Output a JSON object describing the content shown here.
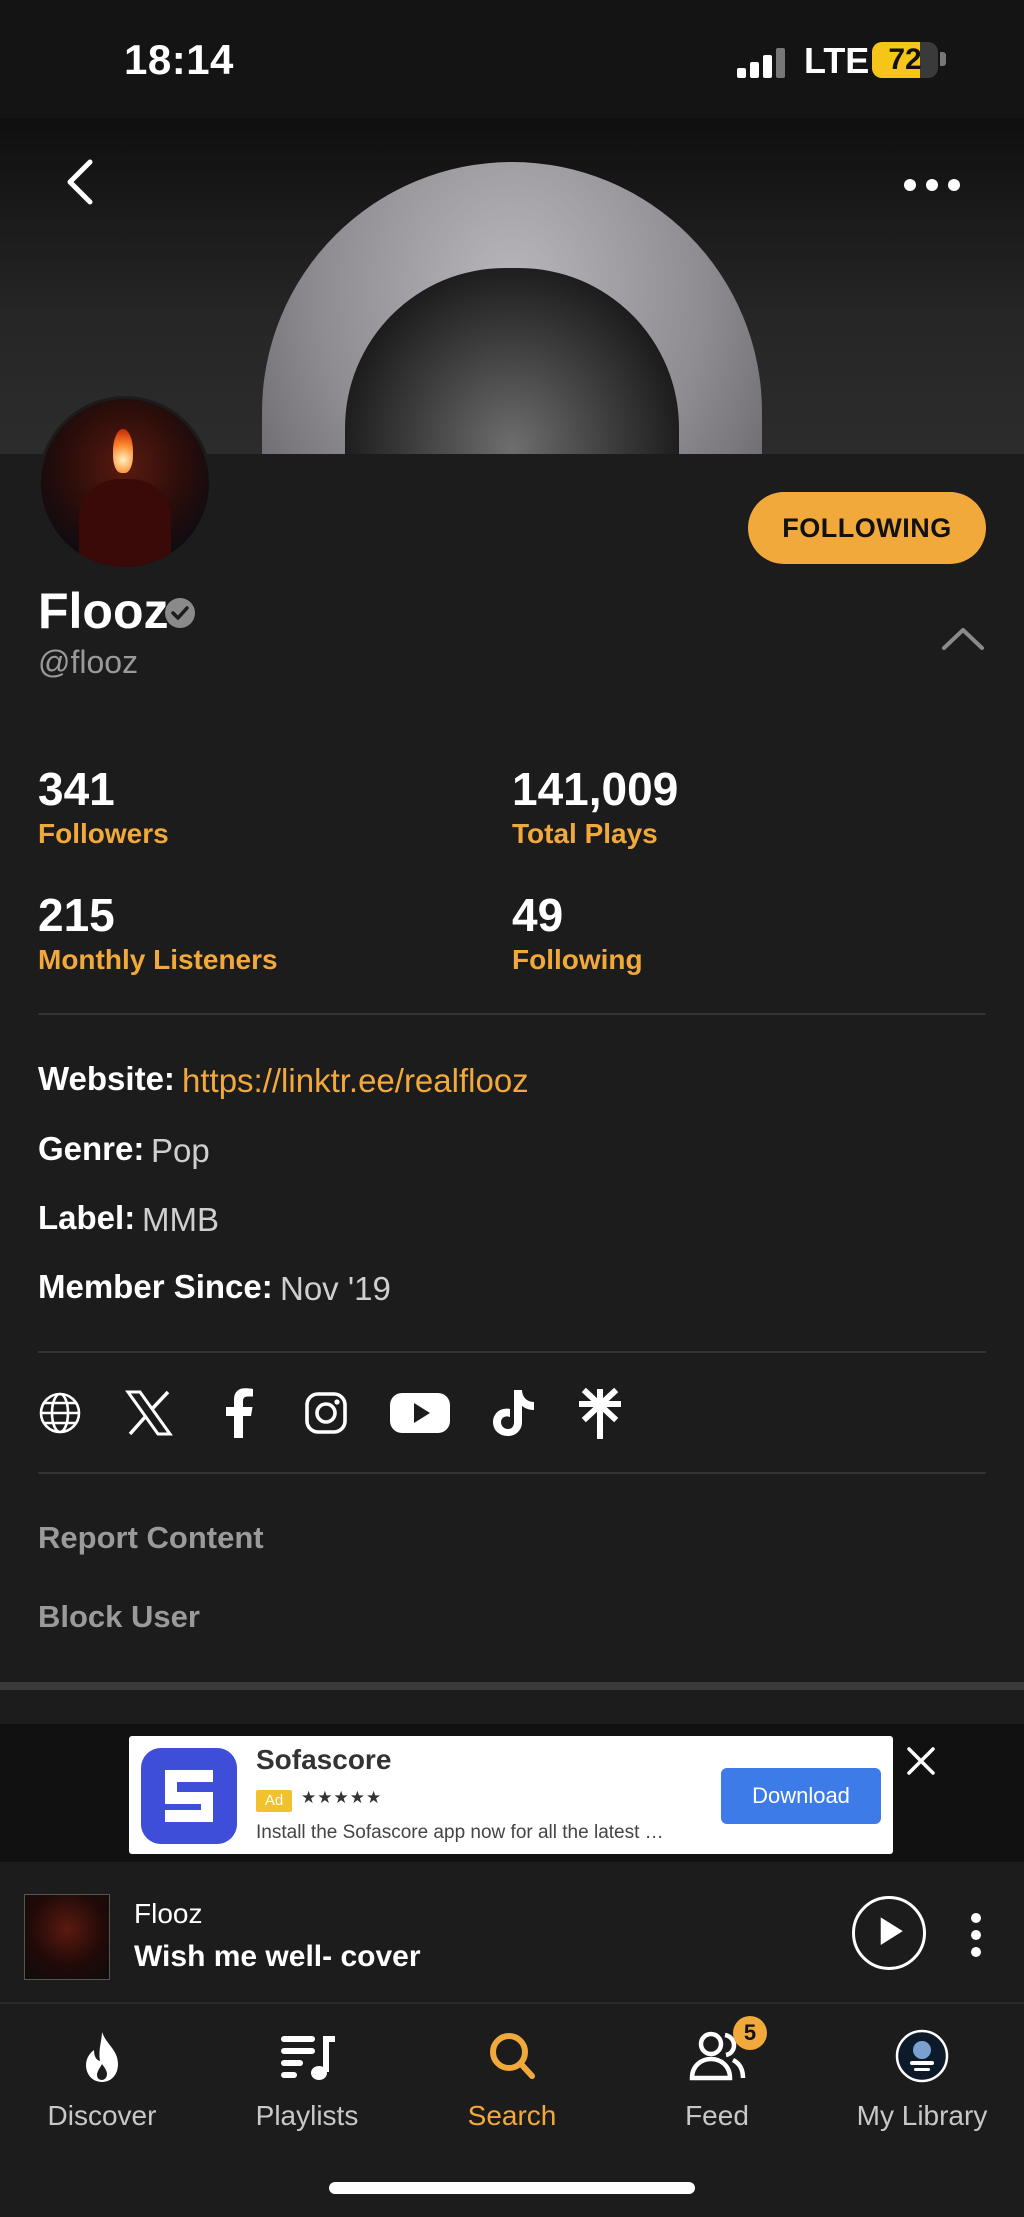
{
  "status_bar": {
    "time": "18:14",
    "network": "LTE",
    "battery": "72",
    "battery_level": 0.72
  },
  "header": {
    "back_icon": "chevron-left-icon",
    "more_icon": "ellipsis-icon"
  },
  "profile": {
    "name": "Flooz",
    "handle": "@flooz",
    "follow_button": "FOLLOWING",
    "stats": [
      {
        "value": "341",
        "label": "Followers"
      },
      {
        "value": "141,009",
        "label": "Total Plays"
      },
      {
        "value": "215",
        "label": "Monthly Listeners"
      },
      {
        "value": "49",
        "label": "Following"
      }
    ],
    "info": {
      "website_label": "Website:",
      "website_value": "https://linktr.ee/realflooz",
      "genre_label": "Genre:",
      "genre_value": "Pop",
      "label_label": "Label:",
      "label_value": "MMB",
      "member_label": "Member Since:",
      "member_value": "Nov '19"
    },
    "socials": [
      "globe-icon",
      "x-icon",
      "facebook-icon",
      "instagram-icon",
      "youtube-icon",
      "tiktok-icon",
      "linktree-icon"
    ],
    "actions": {
      "report": "Report Content",
      "block": "Block User"
    }
  },
  "ad": {
    "title": "Sofascore",
    "badge": "Ad",
    "stars": "★★★★★",
    "description": "Install the Sofascore app now for all the latest …",
    "cta": "Download"
  },
  "now_playing": {
    "artist": "Flooz",
    "title": "Wish me well- cover"
  },
  "tabs": [
    {
      "label": "Discover",
      "icon": "flame-icon"
    },
    {
      "label": "Playlists",
      "icon": "playlist-icon"
    },
    {
      "label": "Search",
      "icon": "search-icon",
      "active": true
    },
    {
      "label": "Feed",
      "icon": "people-icon",
      "badge": "5"
    },
    {
      "label": "My Library",
      "icon": "library-avatar-icon"
    }
  ],
  "colors": {
    "accent": "#f2a93b",
    "background": "#1c1c1c"
  }
}
